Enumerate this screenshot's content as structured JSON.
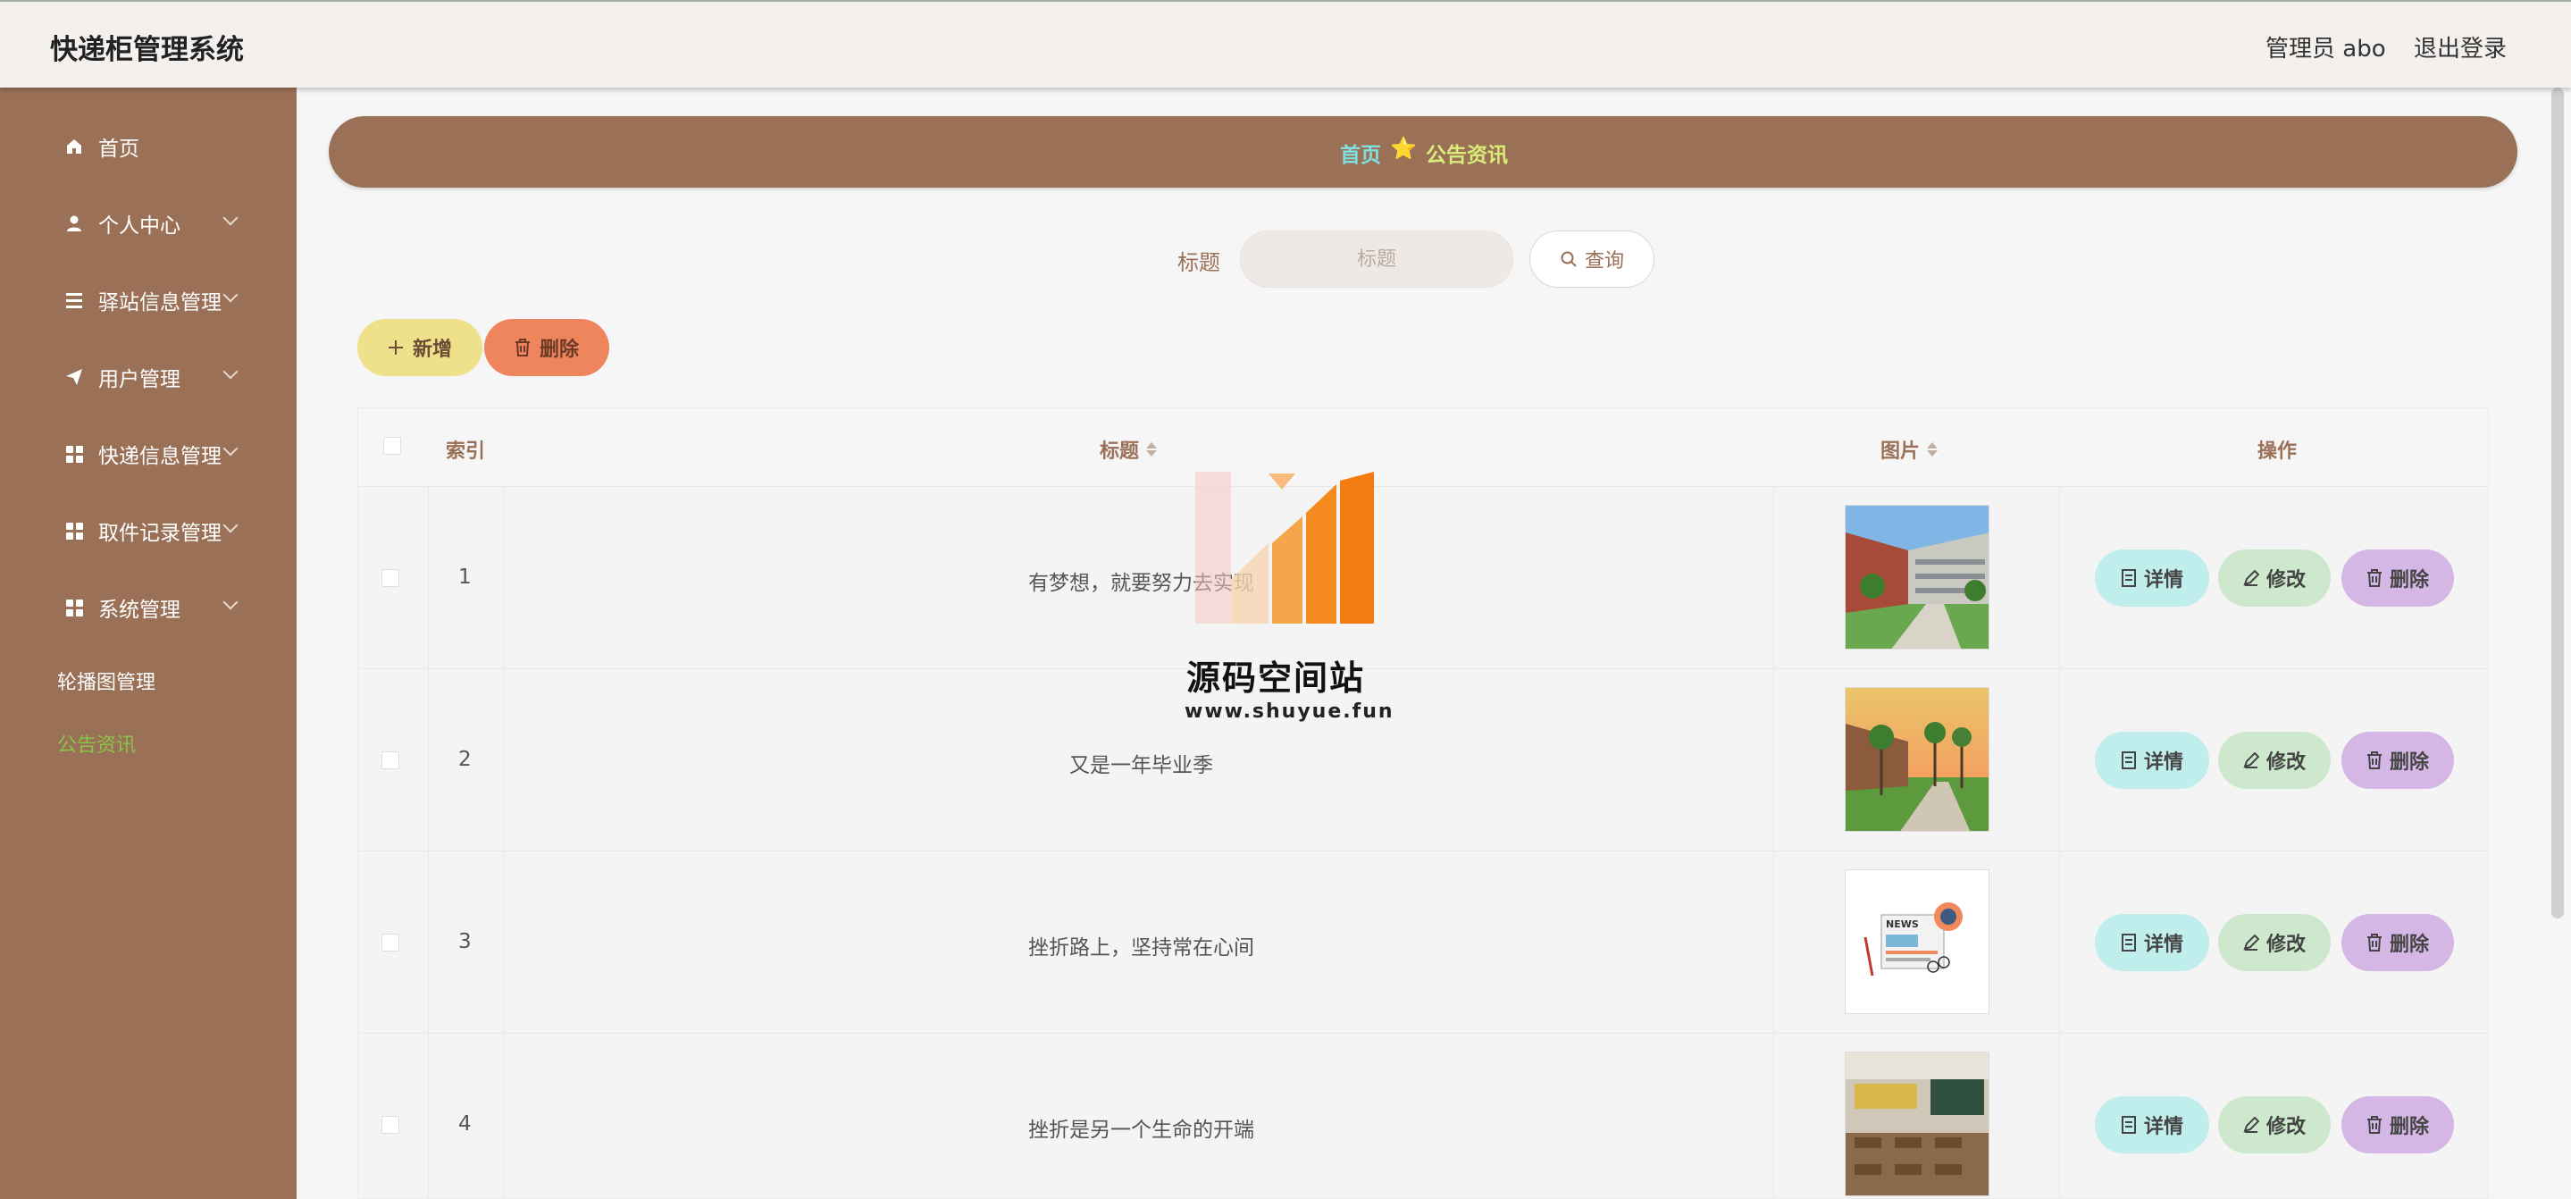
{
  "app": {
    "title": "快递柜管理系统",
    "user": "管理员 abo",
    "logout": "退出登录"
  },
  "sidebar": {
    "items": [
      {
        "label": "首页",
        "icon": "home-icon"
      },
      {
        "label": "个人中心",
        "icon": "user-icon"
      },
      {
        "label": "驿站信息管理",
        "icon": "list-icon"
      },
      {
        "label": "用户管理",
        "icon": "send-icon"
      },
      {
        "label": "快递信息管理",
        "icon": "grid-icon"
      },
      {
        "label": "取件记录管理",
        "icon": "grid-icon"
      },
      {
        "label": "系统管理",
        "icon": "grid-icon"
      }
    ],
    "sub_items": [
      {
        "label": "轮播图管理",
        "active": false
      },
      {
        "label": "公告资讯",
        "active": true
      }
    ]
  },
  "breadcrumb": {
    "home": "首页",
    "separator": "⭐",
    "current": "公告资讯"
  },
  "search": {
    "label": "标题",
    "placeholder": "标题",
    "button": "查询"
  },
  "toolbar": {
    "add": "新增",
    "delete": "删除"
  },
  "table": {
    "columns": [
      "索引",
      "标题",
      "图片",
      "操作"
    ],
    "rows": [
      {
        "index": "1",
        "title": "有梦想，就要努力去实现",
        "image": "school-building-image"
      },
      {
        "index": "2",
        "title": "又是一年毕业季",
        "image": "campus-sunset-image"
      },
      {
        "index": "3",
        "title": "挫折路上，坚持常在心间",
        "image": "news-illustration-image"
      },
      {
        "index": "4",
        "title": "挫折是另一个生命的开端",
        "image": "classroom-image"
      }
    ],
    "actions": {
      "detail": "详情",
      "edit": "修改",
      "delete": "删除"
    }
  },
  "watermark": {
    "name": "源码空间站",
    "url": "www.shuyue.fun"
  },
  "colors": {
    "sidebar": "#9a7157",
    "accent_active": "#8bc34a",
    "add": "#efe08c",
    "delete": "#ee855d",
    "detail": "#bfeeec",
    "edit": "#cde8cc",
    "row_delete": "#d4b7e4"
  }
}
